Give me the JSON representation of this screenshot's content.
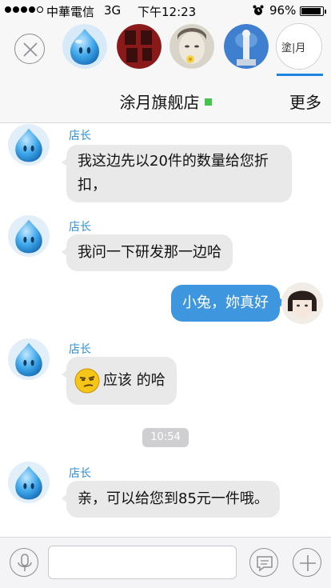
{
  "status_bar": {
    "carrier": "中華電信",
    "network": "3G",
    "time": "下午12:23",
    "battery": "96%"
  },
  "switcher": {
    "avatars": [
      "qq-mascot",
      "calligraphy",
      "girl-with-flower",
      "statue",
      "shop-logo"
    ],
    "shop_logo_text": "塗|月"
  },
  "nav": {
    "title": "涂月旗舰店",
    "more": "更多"
  },
  "messages": [
    {
      "sender": "店长",
      "line1": "我这边先以20件的数量给您折",
      "line2": "扣，"
    },
    {
      "sender": "店长",
      "text": "我问一下研发那一边哈"
    },
    {
      "outgoing": true,
      "text": "小兔，妳真好"
    },
    {
      "sender": "店长",
      "text": "应该 的哈"
    },
    {
      "sender": "店长",
      "text": "亲，可以给您到85元一件哦。"
    }
  ],
  "timestamp": "10:54",
  "input": {
    "placeholder": ""
  },
  "colors": {
    "accent": "#1b86e0",
    "outgoing_bubble": "#3e96df",
    "incoming_bubble": "#e9e9ea",
    "online": "#44c44d"
  }
}
